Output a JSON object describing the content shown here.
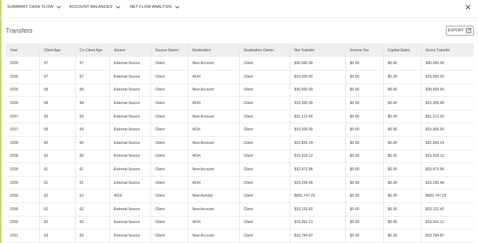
{
  "nav": {
    "tabs": [
      {
        "label": "SUMMARY CASH FLOW"
      },
      {
        "label": "ACCOUNT BALANCES"
      },
      {
        "label": "NET FLOW ANALYSIS"
      }
    ]
  },
  "page": {
    "title": "Transfers",
    "export_label": "EXPORT"
  },
  "table": {
    "columns": [
      "Year",
      "Client Age",
      "Co-Client Age",
      "Source",
      "Source Owner",
      "Destination",
      "Destination Owner",
      "Net Transfer",
      "Income Tax",
      "Capital Gains",
      "Gross Transfer"
    ],
    "rows": [
      [
        "2025",
        "57",
        "57",
        "External Source",
        "Client",
        "New Account",
        "Client",
        "$30,000.00",
        "$0.00",
        "$0.00",
        "$30,000.00"
      ],
      [
        "2025",
        "57",
        "57",
        "External Source",
        "Client",
        "401K",
        "Client",
        "$15,000.00",
        "$0.00",
        "$0.00",
        "$15,000.00"
      ],
      [
        "2026",
        "58",
        "58",
        "External Source",
        "Client",
        "New Account",
        "Client",
        "$30,600.00",
        "$0.00",
        "$0.00",
        "$30,600.00"
      ],
      [
        "2026",
        "58",
        "58",
        "External Source",
        "Client",
        "401K",
        "Client",
        "$15,300.00",
        "$0.00",
        "$0.00",
        "$15,300.00"
      ],
      [
        "2027",
        "59",
        "59",
        "External Source",
        "Client",
        "New Account",
        "Client",
        "$31,212.00",
        "$0.00",
        "$0.00",
        "$31,212.00"
      ],
      [
        "2027",
        "59",
        "59",
        "External Source",
        "Client",
        "401K",
        "Client",
        "$15,606.00",
        "$0.00",
        "$0.00",
        "$15,606.00"
      ],
      [
        "2028",
        "60",
        "60",
        "External Source",
        "Client",
        "New Account",
        "Client",
        "$31,836.24",
        "$0.00",
        "$0.00",
        "$31,836.24"
      ],
      [
        "2028",
        "60",
        "60",
        "External Source",
        "Client",
        "401K",
        "Client",
        "$15,918.12",
        "$0.00",
        "$0.00",
        "$15,918.12"
      ],
      [
        "2029",
        "61",
        "61",
        "External Source",
        "Client",
        "New Account",
        "Client",
        "$32,472.96",
        "$0.00",
        "$0.00",
        "$32,472.96"
      ],
      [
        "2029",
        "61",
        "61",
        "External Source",
        "Client",
        "401K",
        "Client",
        "$16,236.48",
        "$0.00",
        "$0.00",
        "$16,236.48"
      ],
      [
        "2030",
        "62",
        "62",
        "401K",
        "Client",
        "New Annuity",
        "Client",
        "$665,747.29",
        "$0.00",
        "$0.00",
        "$665,747.29"
      ],
      [
        "2030",
        "62",
        "62",
        "External Source",
        "Client",
        "New Account",
        "Client",
        "$33,122.42",
        "$0.00",
        "$0.00",
        "$33,122.42"
      ],
      [
        "2030",
        "62",
        "62",
        "External Source",
        "Client",
        "401K",
        "Client",
        "$16,561.21",
        "$0.00",
        "$0.00",
        "$16,561.21"
      ],
      [
        "2031",
        "63",
        "63",
        "External Source",
        "Client",
        "New Account",
        "Client",
        "$33,784.87",
        "$0.00",
        "$0.00",
        "$33,784.87"
      ]
    ]
  },
  "icons": {
    "tab_chevron": "chevron-down-icon",
    "close": "close-icon",
    "export": "export-icon"
  },
  "colors": {
    "accent": "#c9d94a",
    "header_bg": "#efefef"
  }
}
